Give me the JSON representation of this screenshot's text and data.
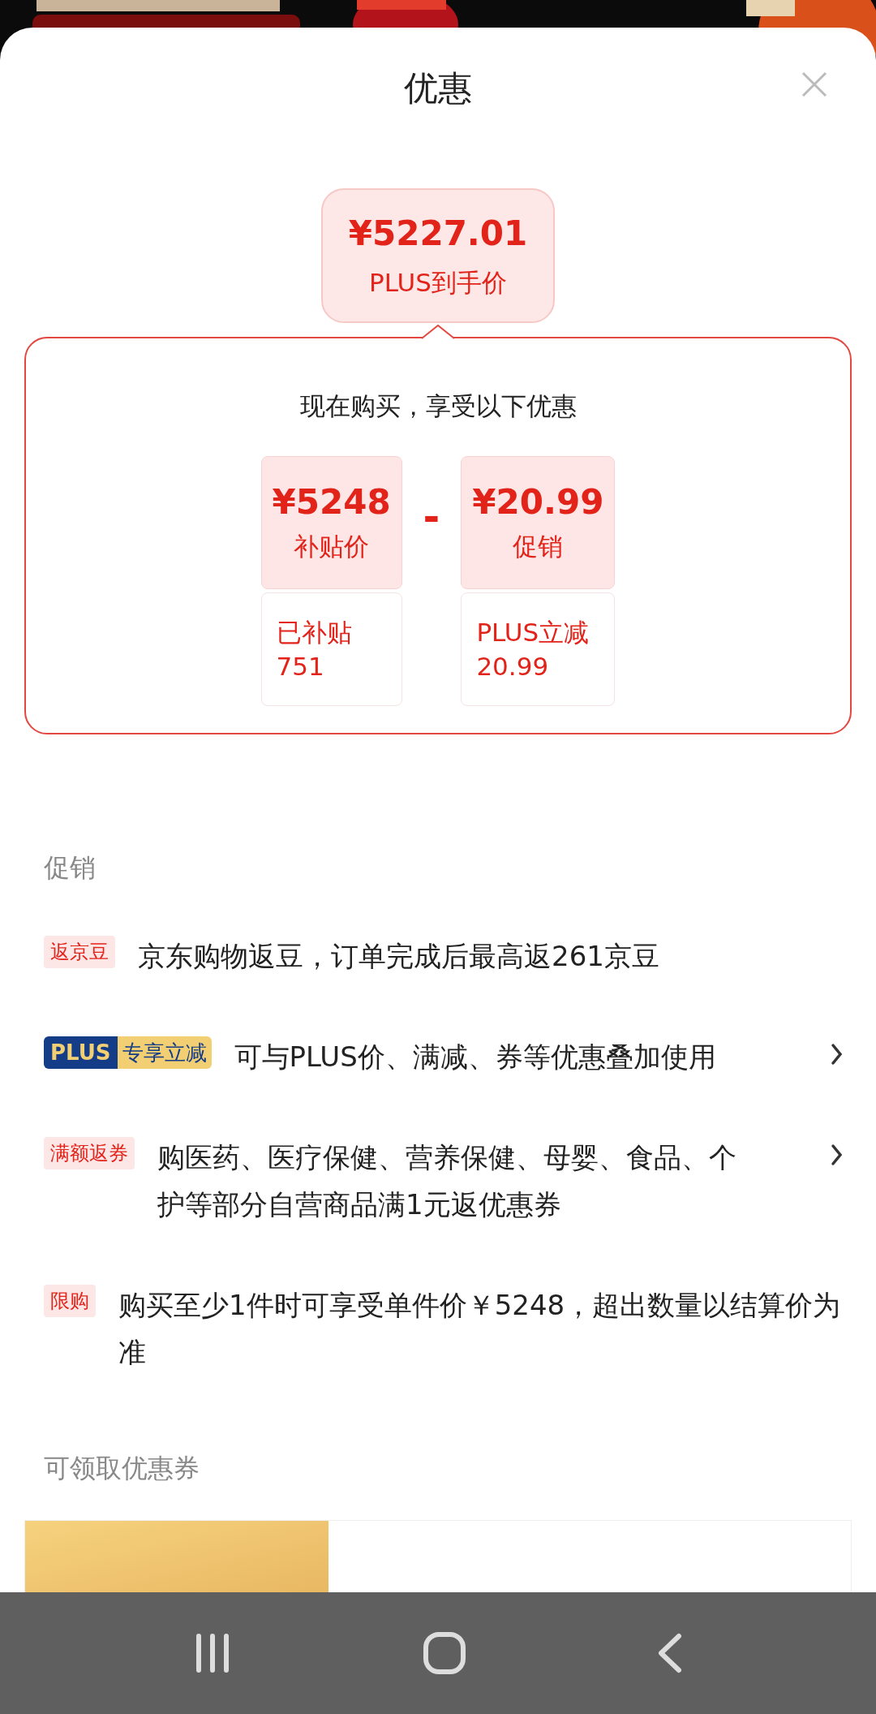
{
  "header": {
    "title": "优惠"
  },
  "final_price": {
    "amount": "¥5227.01",
    "label": "PLUS到手价"
  },
  "breakdown": {
    "heading": "现在购买，享受以下优惠",
    "operator": "-",
    "items": [
      {
        "amount": "¥5248",
        "label": "补贴价",
        "detail_lines": [
          "已补贴",
          "751"
        ]
      },
      {
        "amount": "¥20.99",
        "label": "促销",
        "detail_lines": [
          "PLUS立减",
          "20.99"
        ]
      }
    ]
  },
  "promotions": {
    "title": "促销",
    "items": [
      {
        "kind": "tag",
        "tag": "返京豆",
        "text": "京东购物返豆，订单完成后最高返261京豆",
        "has_arrow": false
      },
      {
        "kind": "plus",
        "tag": "PLUS",
        "tag_extra": "专享立减",
        "text": "可与PLUS价、满减、券等优惠叠加使用",
        "has_arrow": true
      },
      {
        "kind": "tag",
        "tag": "满额返券",
        "text": "购医药、医疗保健、营养保健、母婴、食品、个护等部分自营商品满1元返优惠券",
        "has_arrow": true
      },
      {
        "kind": "tag",
        "tag": "限购",
        "text": "购买至少1件时可享受单件价￥5248，超出数量以结算价为准",
        "has_arrow": false
      }
    ]
  },
  "coupons": {
    "title": "可领取优惠券"
  }
}
